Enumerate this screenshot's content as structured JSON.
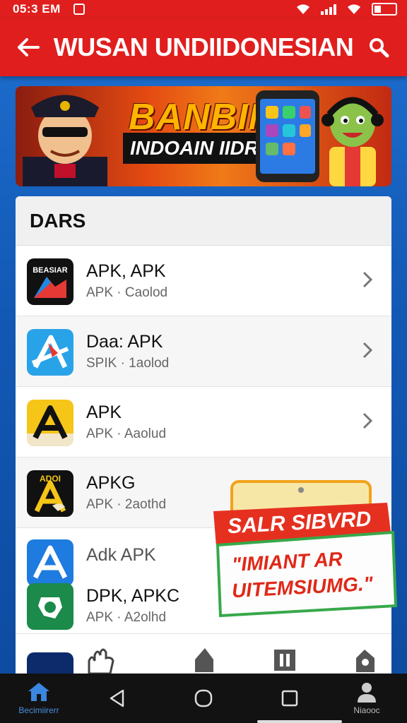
{
  "status": {
    "time": "05:3 EM"
  },
  "appbar": {
    "title": "WUSAN UNDIIDONESIAN"
  },
  "banner": {
    "headline": "BANBIN",
    "subline": "INDOAIN IIDRAN"
  },
  "section": {
    "title": "DARS"
  },
  "list": [
    {
      "title": "APK, APK",
      "subtitle": "APK · Caolod",
      "icon_text": "BEASIAR"
    },
    {
      "title": "Daa: APK",
      "subtitle": "SPIK · 1aolod"
    },
    {
      "title": "APK",
      "subtitle": "APK · Aaolud"
    },
    {
      "title": "APKG",
      "subtitle": "APK · 2aothd",
      "icon_text": "ADOI"
    },
    {
      "title": "Adk APK",
      "subtitle": ""
    },
    {
      "title": "DPK, APKC",
      "subtitle": "APK · A2olhd"
    }
  ],
  "popup": {
    "heading": "SALR SIBVRD",
    "body_line1": "\"IMIANT AR",
    "body_line2": "UITEMSIUMG.\""
  },
  "nav": {
    "left_label": "Becimiirerr",
    "right_label": "Niaooc"
  }
}
